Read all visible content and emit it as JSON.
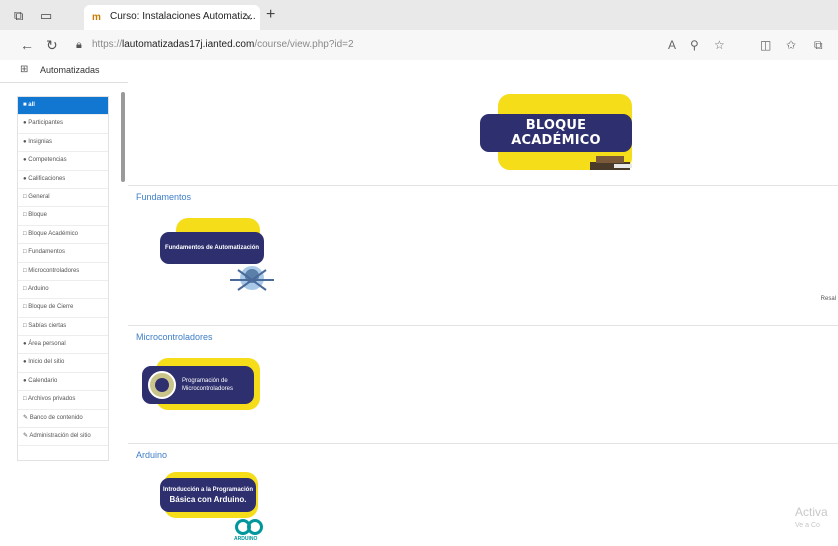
{
  "browser": {
    "tab_title": "Curso: Instalaciones Automatiz...",
    "tab_close": "×",
    "new_tab": "+",
    "url_protocol": "https://",
    "url_host": "lautomatizadas17j.ianted.com",
    "url_path": "/course/view.php?id=2",
    "favorites_label": "Automatizadas"
  },
  "sidebar": {
    "items": [
      {
        "label": "■ all",
        "active": true
      },
      {
        "label": "● Participantes"
      },
      {
        "label": "● Insignias"
      },
      {
        "label": "● Competencias"
      },
      {
        "label": "● Calificaciones"
      },
      {
        "label": "□ General"
      },
      {
        "label": "□ Bloque"
      },
      {
        "label": "□ Bloque Académico"
      },
      {
        "label": "□ Fundamentos"
      },
      {
        "label": "□ Microcontroladores"
      },
      {
        "label": "□ Arduino"
      },
      {
        "label": "□ Bloque de Cierre"
      },
      {
        "label": "□ Sabías ciertas"
      },
      {
        "label": "● Área personal"
      },
      {
        "label": "● Inicio del sitio"
      },
      {
        "label": "● Calendario"
      },
      {
        "label": "□ Archivos privados"
      },
      {
        "label": "✎ Banco de contenido"
      },
      {
        "label": "✎ Administración del sitio"
      }
    ]
  },
  "sections": [
    {
      "title": "",
      "banner": "BLOQUE ACADÉMICO"
    },
    {
      "title": "Fundamentos",
      "banner": "Fundamentos de Automatización",
      "edge": "Resal"
    },
    {
      "title": "Microcontroladores",
      "banner": "Programación de Microcontroladores"
    },
    {
      "title": "Arduino",
      "banner_line1": "Introducción a la Programación",
      "banner_line2": "Básica con Arduino.",
      "logo_caption": "ARDUINO"
    }
  ],
  "watermark": {
    "line1": "Activa",
    "line2": "Ve a Co"
  },
  "colors": {
    "accent": "#1177d1",
    "banner": "#2e2f6e",
    "highlight": "#f6dd1a",
    "link": "#3d7ec9"
  }
}
